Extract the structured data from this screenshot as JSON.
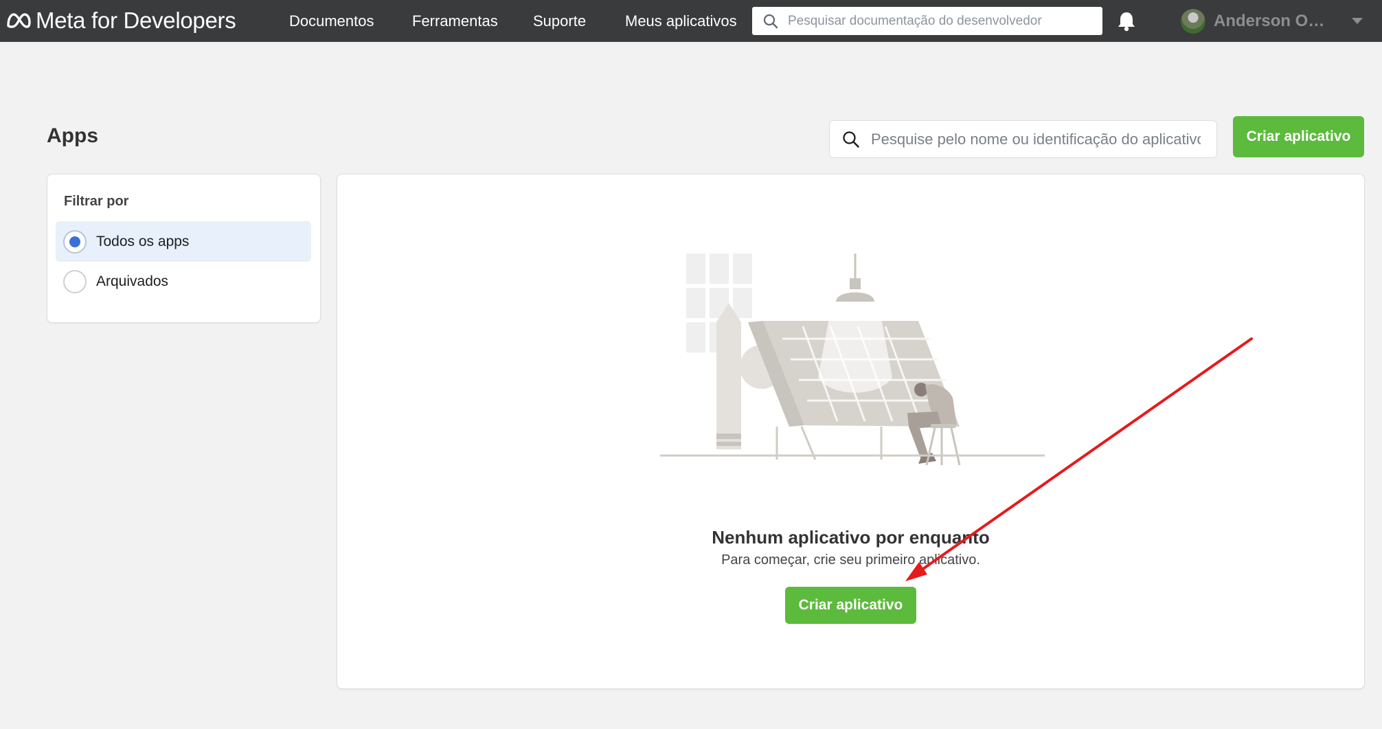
{
  "header": {
    "logo_text": "Meta for Developers",
    "nav": [
      "Documentos",
      "Ferramentas",
      "Suporte",
      "Meus aplicativos"
    ],
    "search_placeholder": "Pesquisar documentação do desenvolvedor",
    "user_name": "Anderson Ouv..."
  },
  "page": {
    "title": "Apps",
    "search_placeholder": "Pesquise pelo nome ou identificação do aplicativo",
    "create_button": "Criar aplicativo"
  },
  "filter": {
    "title": "Filtrar por",
    "options": [
      {
        "label": "Todos os apps",
        "selected": true
      },
      {
        "label": "Arquivados",
        "selected": false
      }
    ]
  },
  "empty_state": {
    "title": "Nenhum aplicativo por enquanto",
    "subtitle": "Para começar, crie seu primeiro aplicativo.",
    "button": "Criar aplicativo"
  },
  "colors": {
    "topbar": "#3a3b3c",
    "accent_green": "#5cba3c",
    "radio_selected": "#3b6fd8",
    "selected_row": "#e7f0fb",
    "annotation_arrow": "#e8191b"
  },
  "icons": [
    "meta-logo-icon",
    "search-icon",
    "bell-icon",
    "chevron-down-icon"
  ]
}
